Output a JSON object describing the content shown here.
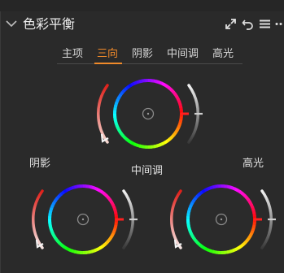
{
  "panel": {
    "title": "色彩平衡",
    "icons": [
      "chevron-down-icon",
      "expand-icon",
      "reset-icon",
      "menu-icon",
      "more-icon"
    ]
  },
  "tabs": {
    "items": [
      {
        "label": "主项",
        "active": false
      },
      {
        "label": "三向",
        "active": true
      },
      {
        "label": "阴影",
        "active": false
      },
      {
        "label": "中间调",
        "active": false
      },
      {
        "label": "高光",
        "active": false
      }
    ],
    "active_color": "#f08a2a"
  },
  "wheels": {
    "master": {
      "label": ""
    },
    "shadows": {
      "label": "阴影"
    },
    "midtones": {
      "label": "中间调"
    },
    "highlights": {
      "label": "高光"
    }
  },
  "colors": {
    "accent": "#f08a2a",
    "indicator": "#ff2020",
    "background": "#2a2a2a"
  }
}
